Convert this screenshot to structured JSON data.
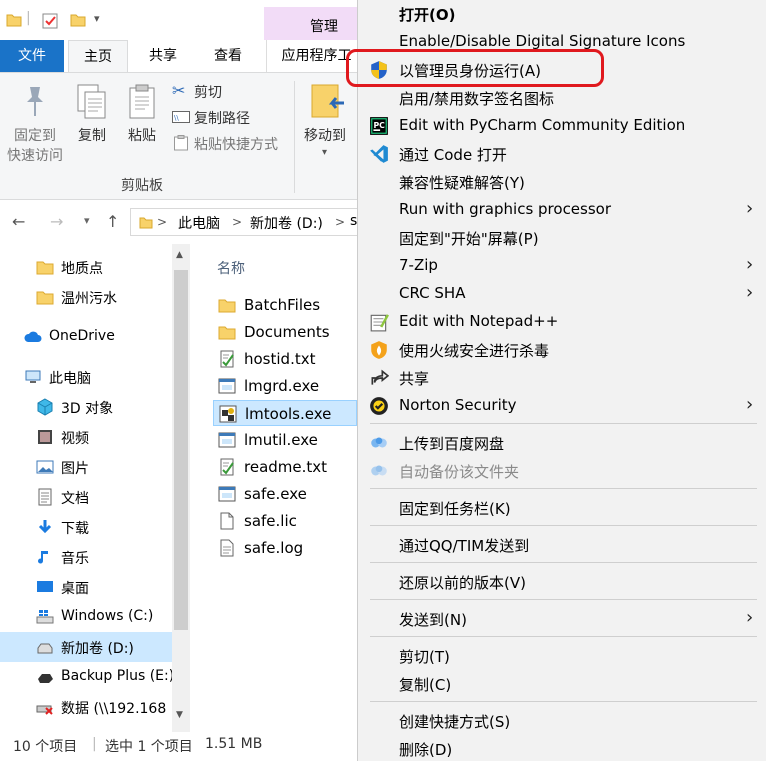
{
  "explorer": {
    "title_context_tab": "管理",
    "ribbon_tabs": [
      "文件",
      "主页",
      "共享",
      "查看",
      "应用程序工"
    ],
    "ribbon": {
      "pin_label_1": "固定到",
      "pin_label_2": "快速访问",
      "copy_label": "复制",
      "paste_label": "粘贴",
      "cut_label": "剪切",
      "copy_path_label": "复制路径",
      "paste_shortcut_label": "粘贴快捷方式",
      "move_to_label": "移动到",
      "group_label": "剪贴板"
    },
    "address": {
      "segments": [
        "此电脑",
        "新加卷 (D:)",
        "s"
      ],
      "separator": ">"
    },
    "nav_items": [
      {
        "label": "地质点",
        "icon": "folder-icon"
      },
      {
        "label": "温州污水",
        "icon": "folder-icon"
      },
      {
        "label": "OneDrive",
        "icon": "cloud-icon"
      },
      {
        "label": "此电脑",
        "icon": "computer-icon"
      },
      {
        "label": "3D 对象",
        "icon": "3d-objects-icon"
      },
      {
        "label": "视频",
        "icon": "video-icon"
      },
      {
        "label": "图片",
        "icon": "picture-icon"
      },
      {
        "label": "文档",
        "icon": "document-icon"
      },
      {
        "label": "下载",
        "icon": "download-icon"
      },
      {
        "label": "音乐",
        "icon": "music-icon"
      },
      {
        "label": "桌面",
        "icon": "desktop-icon"
      },
      {
        "label": "Windows (C:)",
        "icon": "windows-drive-icon"
      },
      {
        "label": "新加卷 (D:)",
        "icon": "drive-icon"
      },
      {
        "label": "Backup Plus (E:)",
        "icon": "external-drive-icon"
      },
      {
        "label": "数据 (\\\\192.168",
        "icon": "network-drive-icon"
      }
    ],
    "file_column_header": "名称",
    "files": [
      {
        "label": "BatchFiles",
        "icon": "folder-icon"
      },
      {
        "label": "Documents",
        "icon": "folder-icon"
      },
      {
        "label": "hostid.txt",
        "icon": "text-file-icon"
      },
      {
        "label": "lmgrd.exe",
        "icon": "exe-icon"
      },
      {
        "label": "lmtools.exe",
        "icon": "lmtools-icon"
      },
      {
        "label": "lmutil.exe",
        "icon": "exe-icon"
      },
      {
        "label": "readme.txt",
        "icon": "text-file-icon"
      },
      {
        "label": "safe.exe",
        "icon": "exe-icon"
      },
      {
        "label": "safe.lic",
        "icon": "file-icon"
      },
      {
        "label": "safe.log",
        "icon": "log-file-icon"
      }
    ],
    "status": {
      "item_count": "10 个项目",
      "selected": "选中 1 个项目",
      "size": "1.51 MB"
    }
  },
  "context_menu": {
    "items": [
      {
        "label": "打开(O)",
        "icon": "",
        "bold": true
      },
      {
        "label": "Enable/Disable Digital Signature Icons",
        "icon": ""
      },
      {
        "label": "以管理员身份运行(A)",
        "icon": "uac-shield-icon"
      },
      {
        "label": "启用/禁用数字签名图标",
        "icon": ""
      },
      {
        "label": "Edit with PyCharm Community Edition",
        "icon": "pycharm-icon"
      },
      {
        "label": "通过 Code 打开",
        "icon": "vscode-icon"
      },
      {
        "label": "兼容性疑难解答(Y)",
        "icon": ""
      },
      {
        "label": "Run with graphics processor",
        "icon": "",
        "submenu": true
      },
      {
        "label": "固定到\"开始\"屏幕(P)",
        "icon": ""
      },
      {
        "label": "7-Zip",
        "icon": "",
        "submenu": true
      },
      {
        "label": "CRC SHA",
        "icon": "",
        "submenu": true
      },
      {
        "label": "Edit with Notepad++",
        "icon": "notepadpp-icon"
      },
      {
        "label": "使用火绒安全进行杀毒",
        "icon": "huorong-icon"
      },
      {
        "label": "共享",
        "icon": "share-icon"
      },
      {
        "label": "Norton Security",
        "icon": "norton-icon",
        "submenu": true
      },
      {
        "label": "上传到百度网盘",
        "icon": "baidu-netdisk-icon"
      },
      {
        "label": "自动备份该文件夹",
        "icon": "baidu-netdisk-icon",
        "disabled": true
      },
      {
        "label": "固定到任务栏(K)",
        "icon": ""
      },
      {
        "label": "通过QQ/TIM发送到",
        "icon": ""
      },
      {
        "label": "还原以前的版本(V)",
        "icon": ""
      },
      {
        "label": "发送到(N)",
        "icon": "",
        "submenu": true
      },
      {
        "label": "剪切(T)",
        "icon": ""
      },
      {
        "label": "复制(C)",
        "icon": ""
      },
      {
        "label": "创建快捷方式(S)",
        "icon": ""
      },
      {
        "label": "删除(D)",
        "icon": ""
      }
    ],
    "submenu_arrow": "›"
  },
  "colors": {
    "file_tab": "#1a73c8",
    "selection": "#cce8ff",
    "highlight_box": "#e0191e",
    "menu_bg": "#f2f2f2",
    "context_tab": "#f2dcf7"
  }
}
